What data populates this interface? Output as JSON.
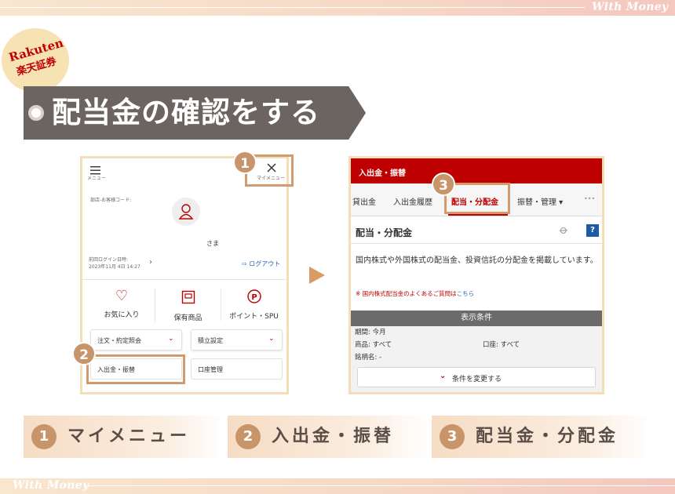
{
  "brand": "With Money",
  "badge": {
    "line1": "Rakuten",
    "line2": "楽天証券"
  },
  "title": "配当金の確認をする",
  "left_panel": {
    "menu_label": "メニュー",
    "my_menu_label": "マイメニュー",
    "branch_code_label": "部店-お客様コード:",
    "name_suffix": "さま",
    "last_login_label": "前回ログイン日時:",
    "last_login_value": "2023年11月 4日 14:27",
    "logout": "ログアウト",
    "favorites": "お気に入り",
    "holdings": "保有商品",
    "points": "ポイント・SPU",
    "orders": "注文・約定照会",
    "savings": "積立設定",
    "deposit": "入出金・振替",
    "account": "口座管理"
  },
  "right_panel": {
    "header": "入出金・振替",
    "tabs": [
      "貸出金",
      "入出金履歴",
      "配当・分配金",
      "振替・管理 ▾"
    ],
    "more": "•••",
    "section_title": "配当・分配金",
    "help": "?",
    "description": "国内株式や外国株式の配当金、投資信託の分配金を掲載しています。",
    "note_prefix": "※ 国内株式配当金のよくあるご質問は",
    "note_link": "こちら",
    "conditions_header": "表示条件",
    "period": "期間: 今月",
    "product": "商品: すべて",
    "account": "口座: すべて",
    "stock_name": "銘柄名: -",
    "change_button": "条件を変更する"
  },
  "step_numbers": [
    "1",
    "2",
    "3"
  ],
  "steps": [
    {
      "num": "1",
      "label": "マイメニュー"
    },
    {
      "num": "2",
      "label": "入出金・振替"
    },
    {
      "num": "3",
      "label": "配当金・分配金"
    }
  ],
  "colors": {
    "accent_red": "#bf0000",
    "step_brown": "#c8946a",
    "banner_gray": "#6c6460"
  }
}
